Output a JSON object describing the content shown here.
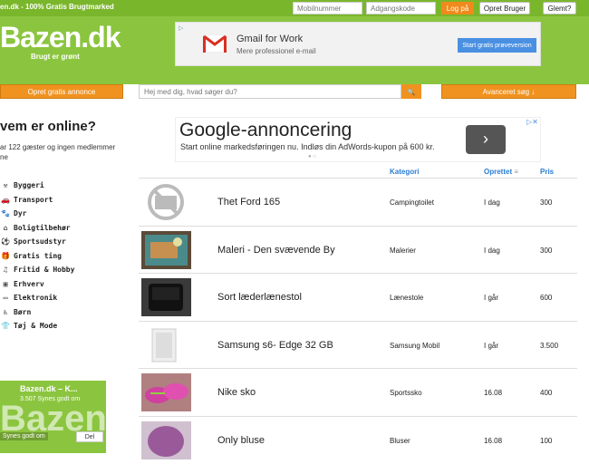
{
  "topbar": {
    "tagline": "en.dk - 100% Gratis Brugtmarked",
    "mobile_placeholder": "Mobilnummer",
    "password_placeholder": "Adgangskode",
    "login_label": "Log på",
    "create_user_label": "Opret Bruger",
    "forgot_label": "Glemt?"
  },
  "header": {
    "logo_text": "Bazen.dk",
    "logo_sub": "Brugt er grønt",
    "ad": {
      "choices_label": "▷",
      "title": "Gmail for Work",
      "subtitle": "Mere professionel e-mail",
      "cta": "Start gratis prøveversion"
    }
  },
  "nav": {
    "create_ad_label": "Opret gratis annonce",
    "search_placeholder": "Hej med dig, hvad søger du?",
    "search_icon_glyph": "🔍",
    "advanced_label": "Avanceret søg ↓"
  },
  "sidebar": {
    "title": "vem er online?",
    "online_text": "ar 122 gæster og ingen medlemmer",
    "online_text2": "ne",
    "categories": [
      {
        "label": "Byggeri",
        "icon": "hammer-icon",
        "glyph": "⚒"
      },
      {
        "label": "Transport",
        "icon": "car-icon",
        "glyph": "🚗"
      },
      {
        "label": "Dyr",
        "icon": "paw-icon",
        "glyph": "🐾"
      },
      {
        "label": "Boligtilbehør",
        "icon": "sofa-icon",
        "glyph": "⌂"
      },
      {
        "label": "Sportsudstyr",
        "icon": "ball-icon",
        "glyph": "⚽"
      },
      {
        "label": "Gratis ting",
        "icon": "gift-icon",
        "glyph": "🎁"
      },
      {
        "label": "Fritid & Hobby",
        "icon": "guitar-icon",
        "glyph": "♫"
      },
      {
        "label": "Erhverv",
        "icon": "briefcase-icon",
        "glyph": "▣"
      },
      {
        "label": "Elektronik",
        "icon": "monitor-icon",
        "glyph": "▭"
      },
      {
        "label": "Børn",
        "icon": "stroller-icon",
        "glyph": "♿"
      },
      {
        "label": "Tøj & Mode",
        "icon": "shirt-icon",
        "glyph": "👕"
      }
    ],
    "fb": {
      "title": "Bazen.dk – K...",
      "likes": "3.507 Synes godt om",
      "big": "Bazen",
      "like_label": "Synes godt om",
      "share_label": "Del"
    }
  },
  "ad2": {
    "headline": "Google-annoncering",
    "desc": "Start online markedsføringen nu. Indløs din AdWords-kupon på 600 kr.",
    "arrow": "›",
    "close": "▷✕"
  },
  "table": {
    "headers": {
      "category": "Kategori",
      "created": "Oprettet",
      "price": "Pris"
    },
    "rows": [
      {
        "title": "Thet Ford 165",
        "category": "Campingtoilet",
        "date": "I dag",
        "price": "300",
        "thumb": "no-photo"
      },
      {
        "title": "Maleri - Den svævende By",
        "category": "Malerier",
        "date": "I dag",
        "price": "300",
        "thumb": "painting"
      },
      {
        "title": "Sort læderlænestol",
        "category": "Lænestole",
        "date": "I går",
        "price": "600",
        "thumb": "chair"
      },
      {
        "title": "Samsung s6- Edge 32 GB",
        "category": "Samsung Mobil",
        "date": "I går",
        "price": "3.500",
        "thumb": "phone"
      },
      {
        "title": "Nike sko",
        "category": "Sportssko",
        "date": "16.08",
        "price": "400",
        "thumb": "shoes"
      },
      {
        "title": "Only bluse",
        "category": "Bluser",
        "date": "16.08",
        "price": "100",
        "thumb": "blouse"
      }
    ]
  },
  "colors": {
    "green": "#8bc53f",
    "dark_green": "#7ab62b",
    "orange": "#f0921f",
    "link_blue": "#2a7dd1"
  }
}
